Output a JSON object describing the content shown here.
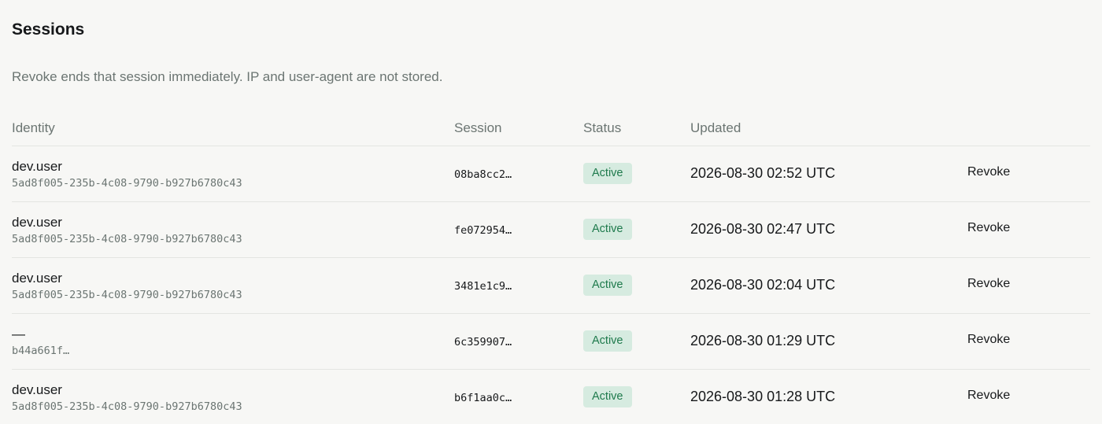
{
  "header": {
    "title": "Sessions",
    "description": "Revoke ends that session immediately. IP and user-agent are not stored."
  },
  "table": {
    "columns": {
      "identity": "Identity",
      "session": "Session",
      "status": "Status",
      "updated": "Updated"
    },
    "rows": [
      {
        "identity_name": "dev.user",
        "identity_id": "5ad8f005-235b-4c08-9790-b927b6780c43",
        "session": "08ba8cc2…",
        "status": "Active",
        "updated": "2026-08-30 02:52 UTC",
        "action": "Revoke"
      },
      {
        "identity_name": "dev.user",
        "identity_id": "5ad8f005-235b-4c08-9790-b927b6780c43",
        "session": "fe072954…",
        "status": "Active",
        "updated": "2026-08-30 02:47 UTC",
        "action": "Revoke"
      },
      {
        "identity_name": "dev.user",
        "identity_id": "5ad8f005-235b-4c08-9790-b927b6780c43",
        "session": "3481e1c9…",
        "status": "Active",
        "updated": "2026-08-30 02:04 UTC",
        "action": "Revoke"
      },
      {
        "identity_name": "—",
        "identity_id": "b44a661f…",
        "session": "6c359907…",
        "status": "Active",
        "updated": "2026-08-30 01:29 UTC",
        "action": "Revoke"
      },
      {
        "identity_name": "dev.user",
        "identity_id": "5ad8f005-235b-4c08-9790-b927b6780c43",
        "session": "b6f1aa0c…",
        "status": "Active",
        "updated": "2026-08-30 01:28 UTC",
        "action": "Revoke"
      }
    ]
  },
  "colors": {
    "background": "#f7f7f5",
    "text": "#16181a",
    "muted": "#6b7572",
    "badge_bg": "#d6ebe0",
    "badge_text": "#1e7a4c",
    "divider": "#e4e5e2"
  }
}
